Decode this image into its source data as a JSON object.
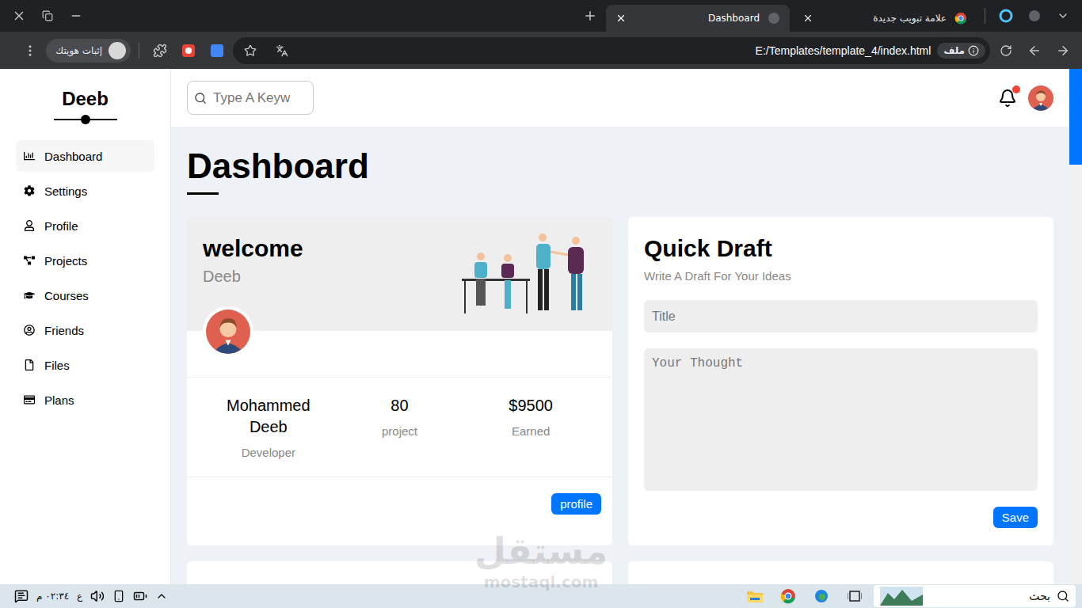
{
  "browser": {
    "tabs": [
      {
        "label": "علامة تبويب جديدة",
        "selected": false
      },
      {
        "label": "Dashboard",
        "selected": true
      }
    ],
    "profile": "إثبات هويتك",
    "address": {
      "chip": "ملف",
      "url": "E:/Templates/template_4/index.html"
    }
  },
  "sidebar": {
    "brand": "Deeb",
    "items": [
      {
        "label": "Dashboard",
        "selected": true
      },
      {
        "label": "Settings",
        "selected": false
      },
      {
        "label": "Profile",
        "selected": false
      },
      {
        "label": "Projects",
        "selected": false
      },
      {
        "label": "Courses",
        "selected": false
      },
      {
        "label": "Friends",
        "selected": false
      },
      {
        "label": "Files",
        "selected": false
      },
      {
        "label": "Plans",
        "selected": false
      }
    ]
  },
  "header": {
    "search": {
      "placeholder": "Type A Keyw"
    },
    "notifications": {
      "unread": true
    }
  },
  "page": {
    "title": "Dashboard"
  },
  "welcome": {
    "title": "welcome",
    "subtitle": "Deeb",
    "stats": [
      {
        "value": "Mohammed Deeb",
        "label": "Developer"
      },
      {
        "value": "80",
        "label": "project"
      },
      {
        "value": "$9500",
        "label": "Earned"
      }
    ],
    "button": "profile"
  },
  "quick_draft": {
    "title": "Quick Draft",
    "subtitle": "Write A Draft For Your Ideas",
    "title_placeholder": "Title",
    "body_placeholder": "Your Thought",
    "button": "Save"
  },
  "watermark": {
    "logo": "مستقل",
    "site": "mostaql.com"
  },
  "taskbar": {
    "search": "بحث",
    "time": "٠٢:٣٤ م",
    "language": "ع"
  }
}
